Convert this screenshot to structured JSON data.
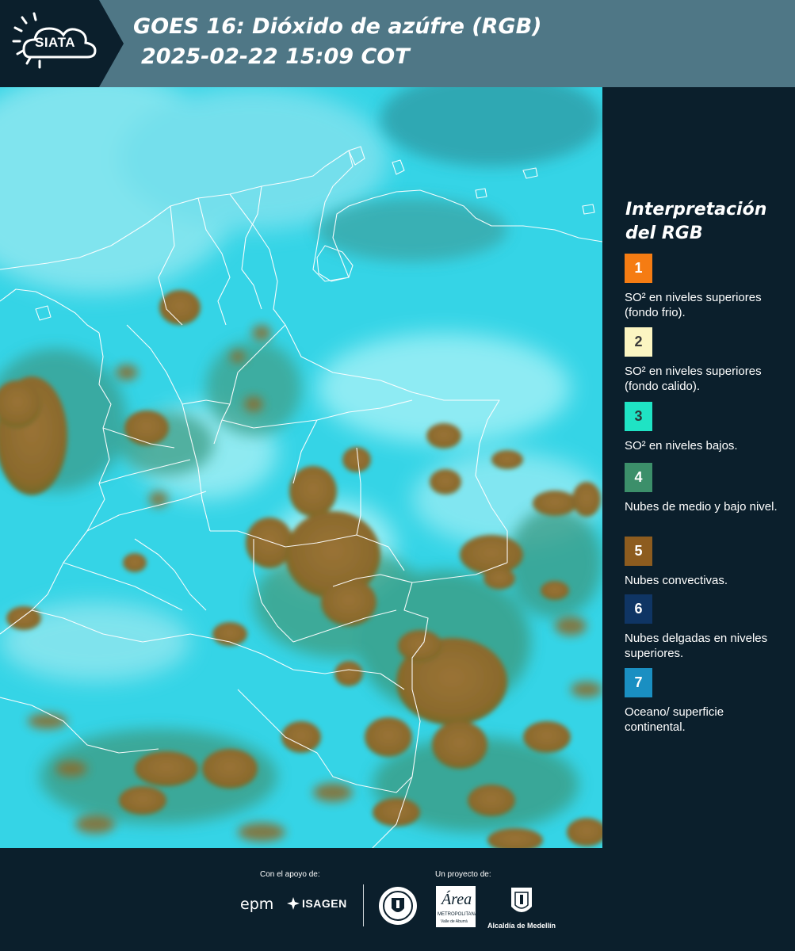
{
  "header": {
    "logo_text": "SIATA",
    "title": "GOES 16: Dióxido de azúfre (RGB)",
    "datetime": "2025-02-22 15:09 COT"
  },
  "legend": {
    "title": "Interpretación del RGB",
    "items": [
      {
        "number": "1",
        "color": "#f57c13",
        "number_color": "#ffffff",
        "text": "SO² en niveles superiores (fondo frio)."
      },
      {
        "number": "2",
        "color": "#fbf5c2",
        "number_color": "#3a3a3a",
        "text": "SO² en niveles superiores (fondo calido)."
      },
      {
        "number": "3",
        "color": "#1fe3c4",
        "number_color": "#2a3a3a",
        "text": "SO² en niveles bajos."
      },
      {
        "number": "4",
        "color": "#3c8f6a",
        "number_color": "#ffffff",
        "text": "Nubes de medio y bajo nivel."
      },
      {
        "number": "5",
        "color": "#8d5c1f",
        "number_color": "#ffffff",
        "text": "Nubes convectivas."
      },
      {
        "number": "6",
        "color": "#0f3564",
        "number_color": "#ffffff",
        "text": "Nubes delgadas en niveles superiores."
      },
      {
        "number": "7",
        "color": "#1a8fc2",
        "number_color": "#ffffff",
        "text": "Oceano/ superficie continental."
      }
    ]
  },
  "footer": {
    "support_label": "Con el apoyo de:",
    "project_label": "Un proyecto de:",
    "sponsor_epm": "epm",
    "sponsor_isagen": "ISAGEN",
    "area_logo_word": "Área",
    "area_logo_sub": "METROPOLITANA",
    "area_logo_sub2": "Valle de Aburrá",
    "alcaldia": "Alcaldía de Medellín"
  }
}
